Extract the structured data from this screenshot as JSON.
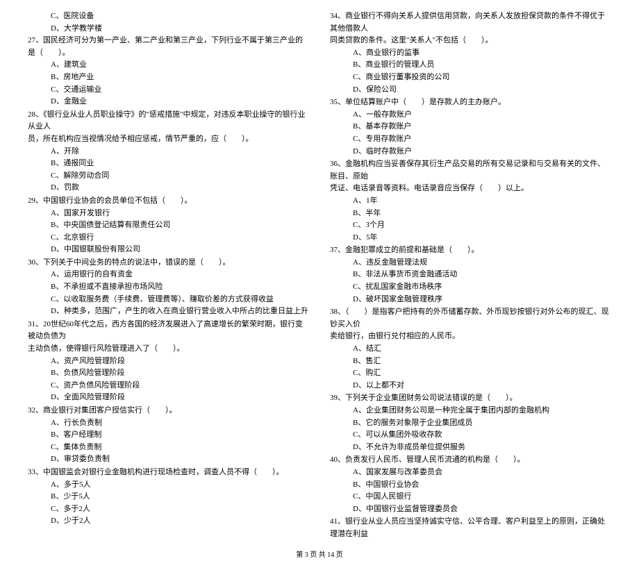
{
  "left": {
    "pre_opts": [
      "C、医院设备",
      "D、大学教学楼"
    ],
    "q27": {
      "stem": "27、国民经济可分为第一产业、第二产业和第三产业，下列行业不属于第三产业的是（　　）。",
      "opts": [
        "A、建筑业",
        "B、房地产业",
        "C、交通运输业",
        "D、金融业"
      ]
    },
    "q28": {
      "stem": "28、《银行业从业人员职业操守》的\"惩戒措施\"中规定，对违反本职业操守的银行业从业人",
      "cont": "员，所在机构应当视情况给予相应惩戒，情节严重的，应（　　）。",
      "opts": [
        "A、开除",
        "B、通报同业",
        "C、解除劳动合同",
        "D、罚款"
      ]
    },
    "q29": {
      "stem": "29、中国银行业协会的会员单位不包括（　　）。",
      "opts": [
        "A、国家开发银行",
        "B、中央国债登记结算有限责任公司",
        "C、北京银行",
        "D、中国银联股份有限公司"
      ]
    },
    "q30": {
      "stem": "30、下列关于中间业务的特点的说法中，错误的是（　　）。",
      "opts": [
        "A、运用银行的自有资金",
        "B、不承担或不直接承担市场风险",
        "C、以收取服务费（手续费、管理费等）、赚取价差的方式获得收益",
        "D、种类多，范围广，产生的收入在商业银行营业收入中所占的比重日益上升"
      ]
    },
    "q31": {
      "stem": "31、20世纪60年代之后，西方各国的经济发展进入了高速增长的繁荣时期，银行变被动负债为",
      "cont": "主动负债，使得银行风险管理进入了（　　）。",
      "opts": [
        "A、资产风险管理阶段",
        "B、负债风险管理阶段",
        "C、资产负债风险管理阶段",
        "D、全面风险管理阶段"
      ]
    },
    "q32": {
      "stem": "32、商业银行对集团客户授信实行（　　）。",
      "opts": [
        "A、行长负责制",
        "B、客户经理制",
        "C、集体负责制",
        "D、审贷委负责制"
      ]
    },
    "q33": {
      "stem": "33、中国银监会对银行业金融机构进行现场检查时，调查人员不得（　　）。",
      "opts": [
        "A、多于5人",
        "B、少于5人",
        "C、多于2人",
        "D、少于2人"
      ]
    }
  },
  "right": {
    "q34": {
      "stem": "34、商业银行不得向关系人提供信用贷款，向关系人发放担保贷款的条件不得优于其他借款人",
      "cont": "同类贷款的条件。这里\"关系人\"不包括（　　）。",
      "opts": [
        "A、商业银行的监事",
        "B、商业银行的管理人员",
        "C、商业银行董事投资的公司",
        "D、保险公司"
      ]
    },
    "q35": {
      "stem": "35、单位结算账户中（　　）是存款人的主办账户。",
      "opts": [
        "A、一般存款账户",
        "B、基本存款账户",
        "C、专用存款账户",
        "D、临时存款账户"
      ]
    },
    "q36": {
      "stem": "36、金融机构应当妥善保存其衍生产品交易的所有交易记录和与交易有关的文件、账目、原始",
      "cont": "凭证、电话录音等资料。电话录音应当保存（　　）以上。",
      "opts": [
        "A、1年",
        "B、半年",
        "C、3个月",
        "D、5年"
      ]
    },
    "q37": {
      "stem": "37、金融犯罪成立的前提和基础是（　　）。",
      "opts": [
        "A、违反金融管理法规",
        "B、非法从事货币资金融通活动",
        "C、扰乱国家金融市场秩序",
        "D、破坏国家金融管理秩序"
      ]
    },
    "q38": {
      "stem": "38、（　　）是指客户把持有的外币储蓄存款、外币现钞按银行对外公布的现汇、现钞买入价",
      "cont": "卖给银行，由银行兑付相应的人民币。",
      "opts": [
        "A、结汇",
        "B、售汇",
        "C、购汇",
        "D、以上都不对"
      ]
    },
    "q39": {
      "stem": "39、下列关于企业集团财务公司说法错误的是（　　）。",
      "opts": [
        "A、企业集团财务公司是一种完全属于集团内部的金融机构",
        "B、它的服务对象限于企业集团成员",
        "C、可以从集团外吸收存款",
        "D、不允许为非成员单位提供服务"
      ]
    },
    "q40": {
      "stem": "40、负责发行人民币、管理人民币流通的机构是（　　）。",
      "opts": [
        "A、国家发展与改革委员会",
        "B、中国银行业协会",
        "C、中国人民银行",
        "D、中国银行业监督管理委员会"
      ]
    },
    "q41": {
      "stem": "41、银行业从业人员应当坚持诚实守信、公平合理、客户利益至上的原则，正确处理潜在利益"
    }
  },
  "footer": "第 3 页 共 14 页"
}
